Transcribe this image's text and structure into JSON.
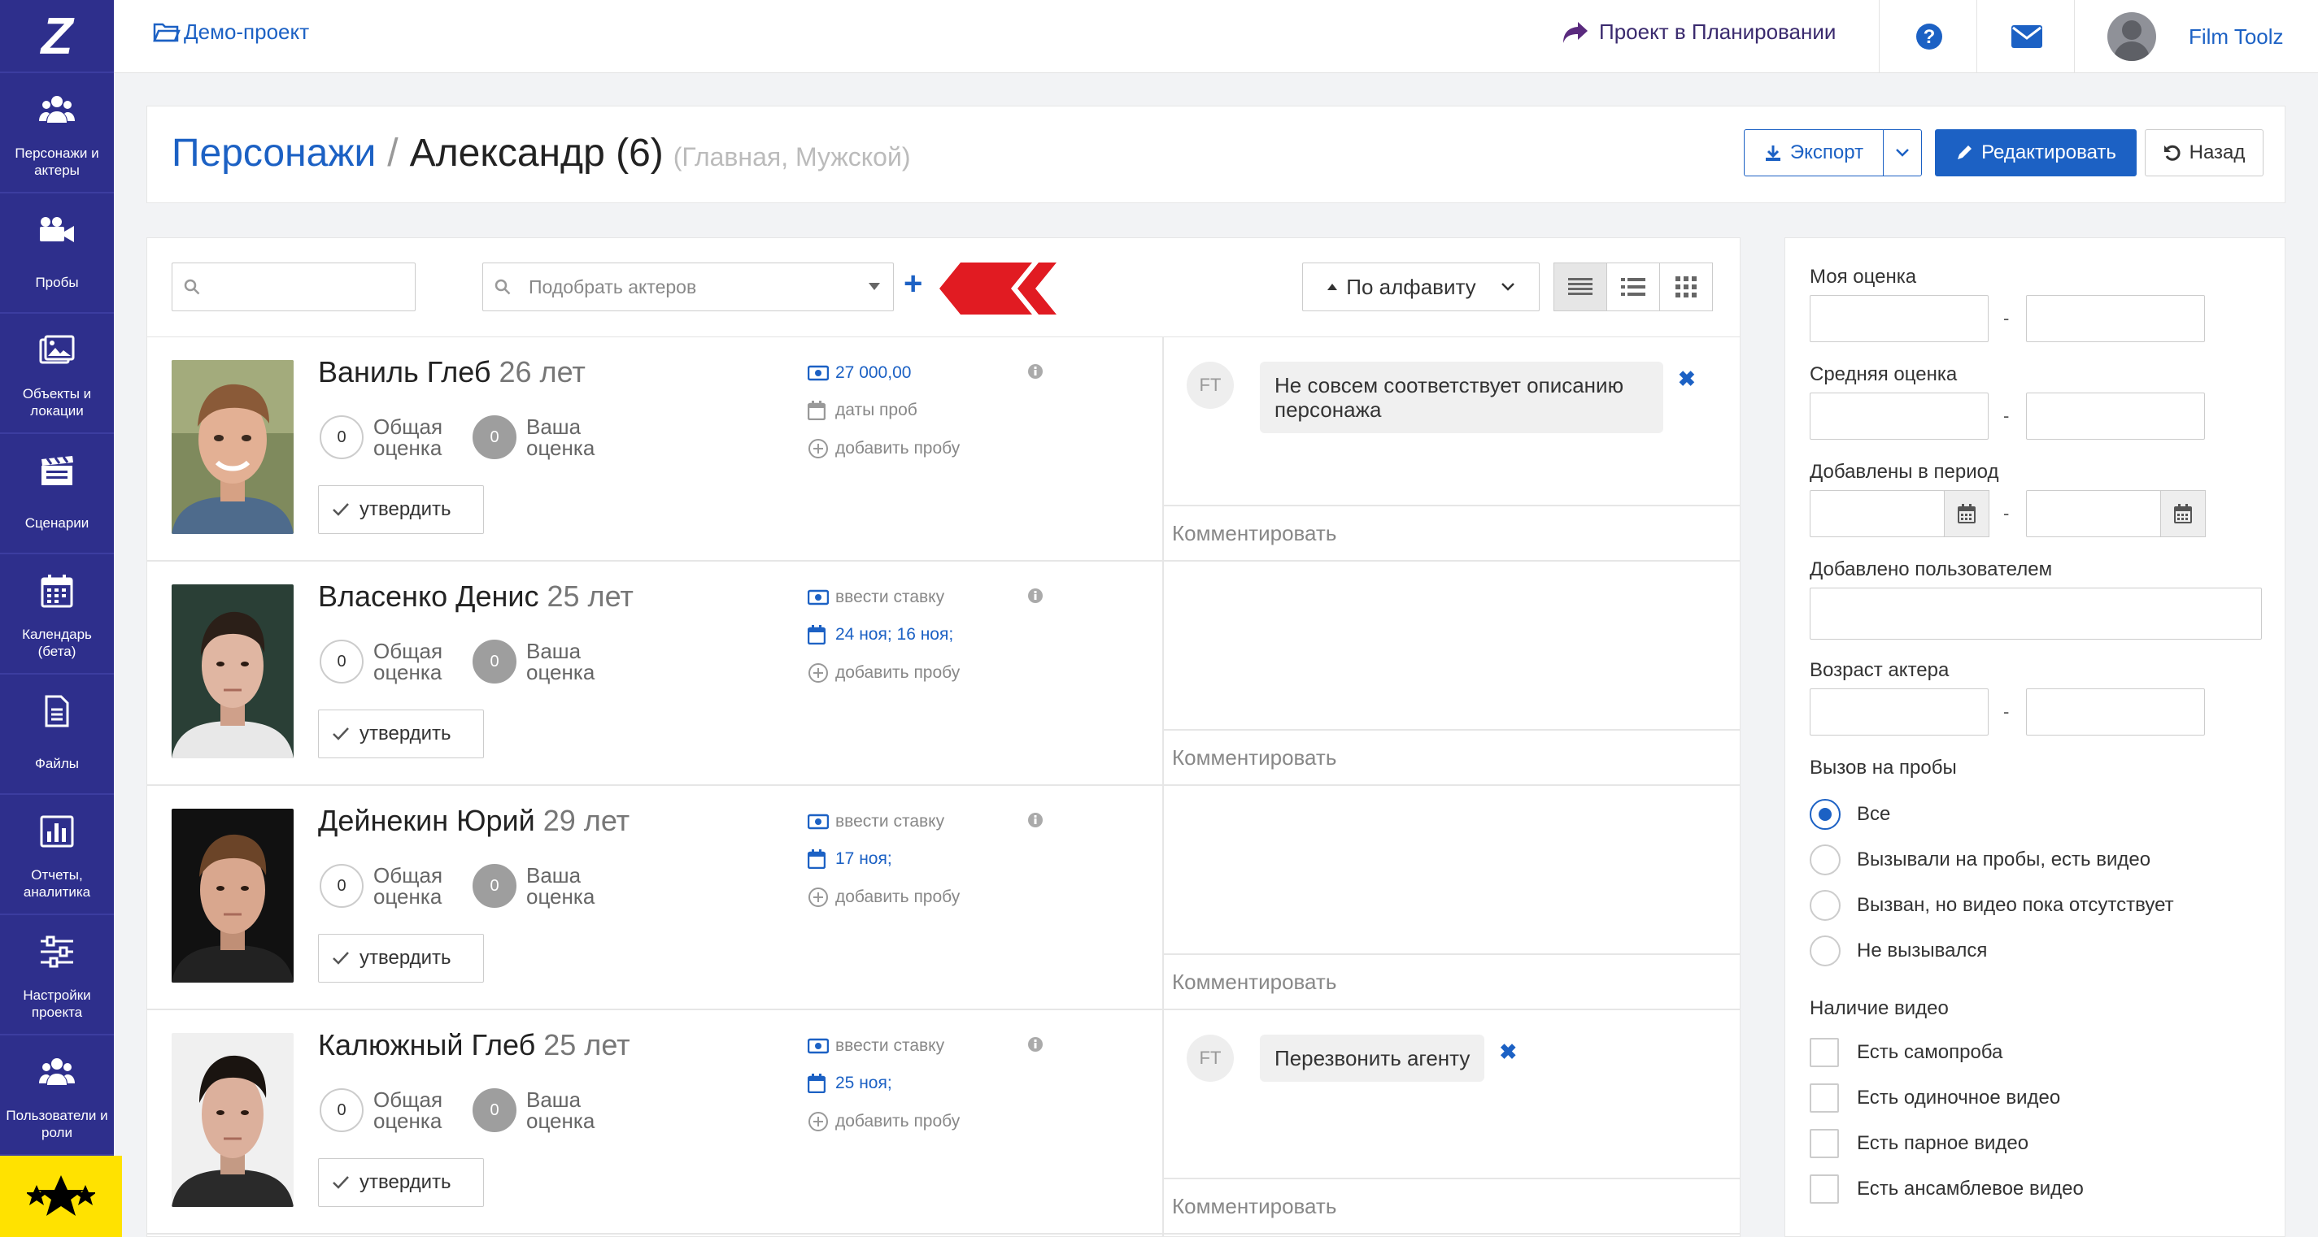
{
  "sidebar": {
    "logo": "Z",
    "items": [
      {
        "label": "Персонажи и актеры",
        "icon": "people-icon"
      },
      {
        "label": "Пробы",
        "icon": "video-camera-icon"
      },
      {
        "label": "Объекты и локации",
        "icon": "image-icon"
      },
      {
        "label": "Сценарии",
        "icon": "clapperboard-icon"
      },
      {
        "label": "Календарь (бета)",
        "icon": "calendar-icon"
      },
      {
        "label": "Файлы",
        "icon": "file-icon"
      },
      {
        "label": "Отчеты, аналитика",
        "icon": "bar-chart-icon"
      },
      {
        "label": "Настройки проекта",
        "icon": "sliders-icon"
      },
      {
        "label": "Пользователи и роли",
        "icon": "users-icon"
      }
    ]
  },
  "topbar": {
    "project": "Демо-проект",
    "planning": "Проект в Планировании",
    "user": "Film Toolz"
  },
  "header": {
    "crumb_link": "Персонажи",
    "separator": "/",
    "title": "Александр (6)",
    "subtitle": "(Главная, Мужской)",
    "export": "Экспорт",
    "edit": "Редактировать",
    "back": "Назад"
  },
  "toolbar": {
    "search_placeholder": "",
    "pick_actors": "Подобрать актеров",
    "sort": "По алфавиту"
  },
  "labels": {
    "overall": "Общая",
    "your": "Ваша",
    "score": "оценка",
    "approve": "утвердить",
    "add_test": "добавить пробу",
    "comment": "Комментировать"
  },
  "actors": [
    {
      "name": "Ваниль Глеб",
      "age": "26 лет",
      "overall": "0",
      "yours": "0",
      "rate": "27 000,00",
      "rate_set": true,
      "dates": "даты проб",
      "dates_set": false,
      "note": {
        "initials": "FT",
        "text": "Не совсем соответствует описанию персонажа"
      }
    },
    {
      "name": "Власенко Денис",
      "age": "25 лет",
      "overall": "0",
      "yours": "0",
      "rate": "ввести ставку",
      "rate_set": false,
      "dates": "24 ноя; 16 ноя;",
      "dates_set": true,
      "note": null
    },
    {
      "name": "Дейнекин Юрий",
      "age": "29 лет",
      "overall": "0",
      "yours": "0",
      "rate": "ввести ставку",
      "rate_set": false,
      "dates": "17 ноя;",
      "dates_set": true,
      "note": null
    },
    {
      "name": "Калюжный Глеб",
      "age": "25 лет",
      "overall": "0",
      "yours": "0",
      "rate": "ввести ставку",
      "rate_set": false,
      "dates": "25 ноя;",
      "dates_set": true,
      "note": {
        "initials": "FT",
        "text": "Перезвонить агенту"
      }
    }
  ],
  "filters": {
    "my_rating": "Моя оценка",
    "avg_rating": "Средняя оценка",
    "added_period": "Добавлены в период",
    "added_by": "Добавлено пользователем",
    "actor_age": "Возраст актера",
    "range_dash": "-",
    "call_title": "Вызов на пробы",
    "call_options": [
      "Все",
      "Вызывали на пробы, есть видео",
      "Вызван, но видео пока отсутствует",
      "Не вызывался"
    ],
    "call_selected": "Все",
    "video_title": "Наличие видео",
    "video_options": [
      "Есть самопроба",
      "Есть одиночное видео",
      "Есть парное видео",
      "Есть ансамблевое видео"
    ]
  },
  "colors": {
    "sidebar": "#2e2f8c",
    "accent": "#1c61c4",
    "arrows": "#e11b22",
    "star_bg": "#ffe200"
  }
}
